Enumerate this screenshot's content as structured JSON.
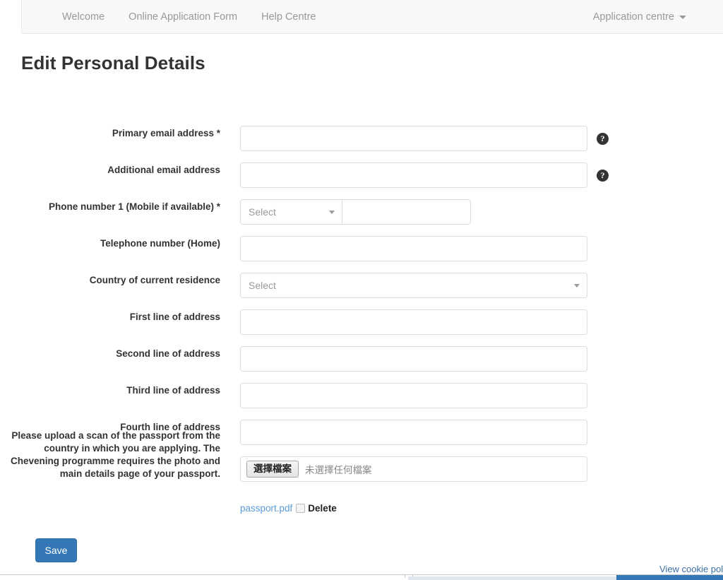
{
  "nav": {
    "items": [
      {
        "label": "Welcome"
      },
      {
        "label": "Online Application Form"
      },
      {
        "label": "Help Centre"
      }
    ],
    "account_menu": {
      "label": "Application centre",
      "caret_icon": "chevron-down-icon"
    }
  },
  "page": {
    "title": "Edit Personal Details"
  },
  "form": {
    "help_icon_glyph": "?",
    "fields": {
      "primary_email": {
        "label": "Primary email address *",
        "value": "",
        "placeholder": ""
      },
      "additional_email": {
        "label": "Additional email address",
        "value": "",
        "placeholder": ""
      },
      "phone_1": {
        "label": "Phone number 1 (Mobile if available) *",
        "code_selected": "Select",
        "number_value": "",
        "number_placeholder": ""
      },
      "telephone_home": {
        "label": "Telephone number (Home)",
        "value": "",
        "placeholder": ""
      },
      "country_residence": {
        "label": "Country of current residence",
        "selected": "Select"
      },
      "address_1": {
        "label": "First line of address",
        "value": "",
        "placeholder": ""
      },
      "address_2": {
        "label": "Second line of address",
        "value": "",
        "placeholder": ""
      },
      "address_3": {
        "label": "Third line of address",
        "value": "",
        "placeholder": ""
      },
      "address_4": {
        "label": "Fourth line of address",
        "value": "",
        "placeholder": ""
      },
      "passport_upload": {
        "label": "Please upload a scan of the passport from the country in which you are applying. The Chevening programme requires the photo and main details page of your passport.",
        "choose_button": "選擇檔案",
        "status_text": "未選擇任何檔案",
        "existing_file_name": "passport.pdf",
        "delete_label": "Delete"
      }
    },
    "save_label": "Save"
  },
  "footer": {
    "cookie_link": "View cookie policy"
  },
  "colors": {
    "accent": "#3479b5",
    "link": "#5b9bd5",
    "nav_text": "#999999",
    "label_text": "#333333",
    "input_border": "#dddddd"
  }
}
